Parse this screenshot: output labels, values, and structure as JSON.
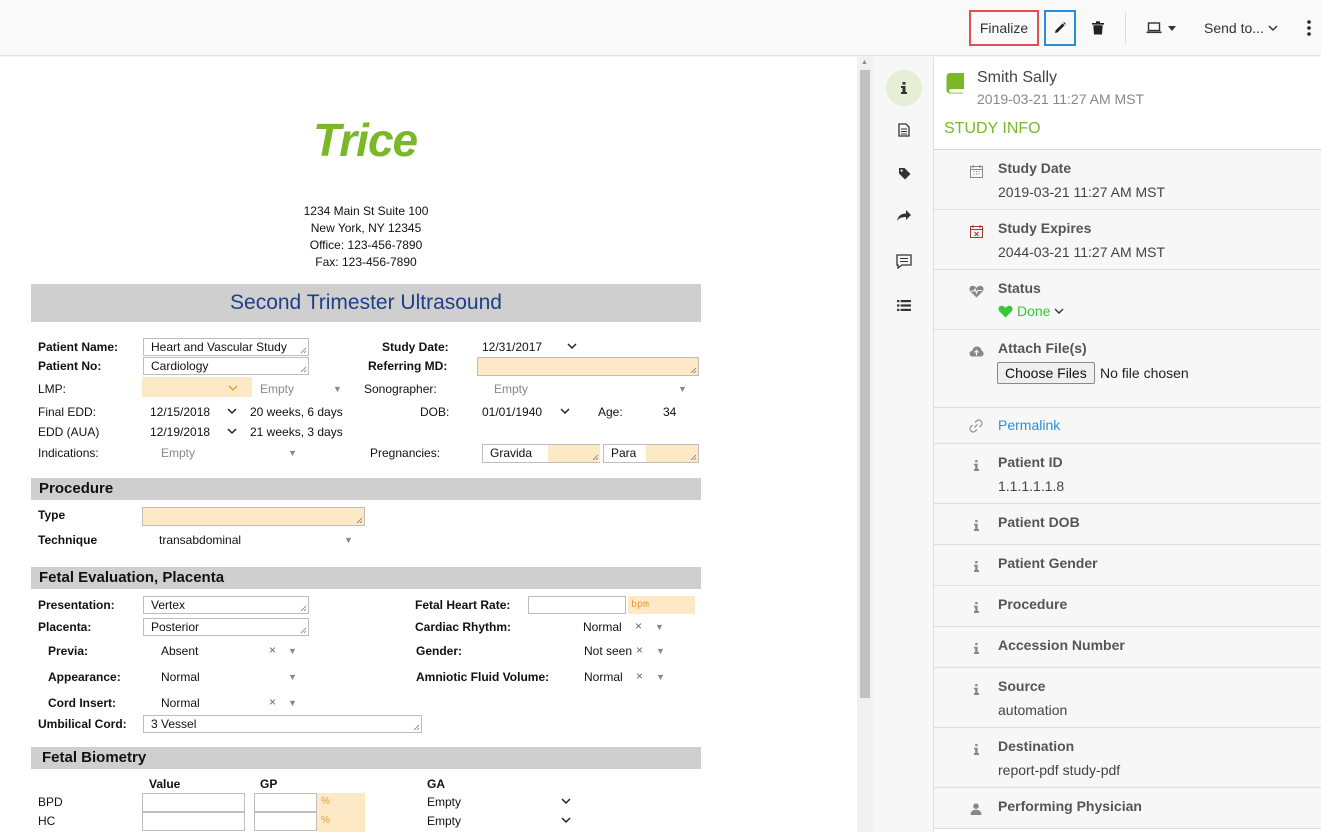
{
  "toolbar": {
    "finalize_label": "Finalize",
    "send_to_label": "Send to..."
  },
  "header": {
    "patient_name": "Smith Sally",
    "timestamp": "2019-03-21 11:27 AM MST",
    "section_title": "STUDY INFO"
  },
  "sidebar": {
    "study_date": {
      "label": "Study Date",
      "value": "2019-03-21 11:27 AM MST"
    },
    "study_expires": {
      "label": "Study Expires",
      "value": "2044-03-21 11:27 AM MST"
    },
    "status": {
      "label": "Status",
      "value": "Done"
    },
    "attach": {
      "label": "Attach File(s)",
      "button": "Choose Files",
      "no_file": "No file chosen"
    },
    "permalink": "Permalink",
    "patient_id": {
      "label": "Patient ID",
      "value": "1.1.1.1.1.8"
    },
    "patient_dob": {
      "label": "Patient DOB"
    },
    "patient_gender": {
      "label": "Patient Gender"
    },
    "procedure": {
      "label": "Procedure"
    },
    "accession": {
      "label": "Accession Number"
    },
    "source": {
      "label": "Source",
      "value": "automation"
    },
    "destination": {
      "label": "Destination",
      "value": "report-pdf study-pdf"
    },
    "performing_physician": {
      "label": "Performing Physician"
    }
  },
  "colors": {
    "accent_green": "#7ab829",
    "status_green": "#37c837",
    "link_blue": "#2a8fd9",
    "finalize_border": "#e05252",
    "field_yellow": "#fde9c6"
  },
  "report": {
    "logo": "Trice",
    "address": [
      "1234 Main St Suite 100",
      "New York, NY 12345",
      "Office: 123-456-7890",
      "Fax: 123-456-7890"
    ],
    "title": "Second Trimester Ultrasound",
    "labels": {
      "patient_name": "Patient Name:",
      "patient_no": "Patient No:",
      "lmp": "LMP:",
      "final_edd": "Final EDD:",
      "edd_aua": "EDD (AUA)",
      "indications": "Indications:",
      "study_date": "Study Date:",
      "referring_md": "Referring MD:",
      "sonographer": "Sonographer:",
      "dob": "DOB:",
      "age": "Age:",
      "pregnancies": "Pregnancies:",
      "type": "Type",
      "technique": "Technique",
      "presentation": "Presentation:",
      "placenta": "Placenta:",
      "previa": "Previa:",
      "appearance": "Appearance:",
      "cord_insert": "Cord Insert:",
      "umbilical_cord": "Umbilical Cord:",
      "fetal_heart_rate": "Fetal Heart Rate:",
      "cardiac_rhythm": "Cardiac Rhythm:",
      "gender": "Gender:",
      "amniotic": "Amniotic Fluid Volume:",
      "value": "Value",
      "gp": "GP",
      "ga": "GA",
      "bpd": "BPD",
      "hc": "HC"
    },
    "values": {
      "patient_name": "Heart and Vascular Study",
      "patient_no": "Cardiology",
      "lmp_empty": "Empty",
      "final_edd": "12/15/2018",
      "final_edd_ga": "20 weeks, 6 days",
      "edd_aua": "12/19/2018",
      "edd_aua_ga": "21 weeks, 3 days",
      "indications": "Empty",
      "study_date": "12/31/2017",
      "sonographer": "Empty",
      "dob": "01/01/1940",
      "age": "34",
      "gravida": "Gravida",
      "para": "Para",
      "technique": "transabdominal",
      "presentation": "Vertex",
      "placenta": "Posterior",
      "previa": "Absent",
      "appearance": "Normal",
      "cord_insert": "Normal",
      "umbilical_cord": "3 Vessel",
      "bpm": "bpm",
      "cardiac_rhythm": "Normal",
      "gender": "Not seen",
      "amniotic": "Normal",
      "percent": "%",
      "ga_empty": "Empty"
    },
    "sections": {
      "procedure": "Procedure",
      "fetal_eval": "Fetal Evaluation, Placenta",
      "fetal_biometry": "Fetal Biometry"
    }
  }
}
